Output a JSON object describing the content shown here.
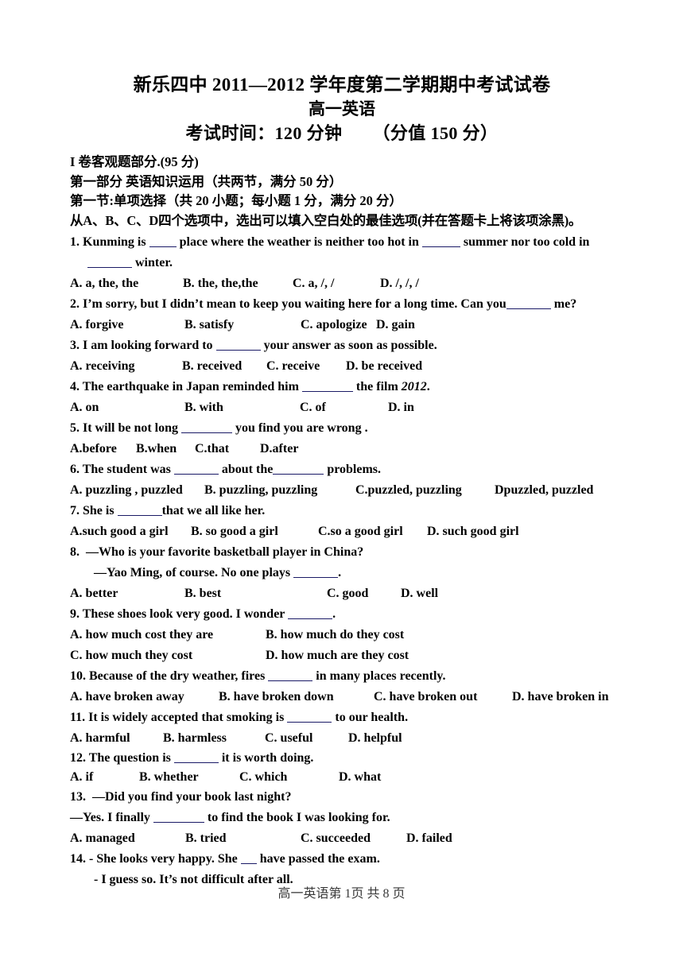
{
  "header": {
    "title_main": "新乐四中 2011—2012 学年度第二学期期中考试试卷",
    "title_sub": "高一英语",
    "exam_time_label": "考试时间：120 分钟",
    "exam_score_label": "（分值 150 分）"
  },
  "instructions": {
    "line1": "I 卷客观题部分.(95 分)",
    "line2": "第一部分 英语知识运用（共两节，满分 50 分）",
    "line3": "第一节:单项选择（共 20 小题；每小题 1 分，满分 20 分）",
    "line4": "从A、B、C、D四个选项中，选出可以填入空白处的最佳选项(并在答题卡上将该项涂黑)。"
  },
  "questions": [
    {
      "number": "1.",
      "stem_part1": "Kunming is",
      "stem_part2": "place where the weather is neither too hot in",
      "stem_part3": "summer nor too cold in",
      "stem_part4": "winter.",
      "options": [
        "A. a, the, the",
        "B. the, the,the",
        "C. a, /, /",
        "D. /, /, /"
      ]
    },
    {
      "number": "2.",
      "stem_part1": "I’m sorry, but I didn’t mean to keep you waiting here for a long time. Can you",
      "stem_part2": "me?",
      "options": [
        "A. forgive",
        "B. satisfy",
        "C. apologize",
        "D. gain"
      ]
    },
    {
      "number": "3.",
      "stem_part1": "I am looking forward to",
      "stem_part2": "your answer as soon as possible.",
      "options": [
        "A. receiving",
        "B. received",
        "C. receive",
        "D. be received"
      ]
    },
    {
      "number": "4.",
      "stem_part1": "The earthquake in Japan reminded him",
      "stem_part2": "the film",
      "stem_italic": "2012",
      "stem_part3": ".",
      "options": [
        "A. on",
        "B. with",
        "C. of",
        "D. in"
      ]
    },
    {
      "number": "5.",
      "stem_part1": "It will be not long",
      "stem_part2": "you find you are wrong .",
      "options": [
        "A.before",
        "B.when",
        "C.that",
        "D.after"
      ]
    },
    {
      "number": "6.",
      "stem_part1": "The student was",
      "stem_part2": "about the",
      "stem_part3": "problems.",
      "options": [
        "A. puzzling , puzzled",
        "B. puzzling, puzzling",
        "C.puzzled, puzzling",
        "Dpuzzled, puzzled"
      ]
    },
    {
      "number": "7.",
      "stem_part1": "She is",
      "stem_part2": "that we all like her.",
      "options": [
        "A.such good a girl",
        "B. so good a girl",
        "C.so a good girl",
        "D. such good girl"
      ]
    },
    {
      "number": "8.",
      "stem_part1": "—Who is your favorite basketball player in China?",
      "stem_line2_part1": "—Yao Ming, of course. No one plays",
      "stem_line2_part2": ".",
      "options": [
        "A. better",
        "B. best",
        "C. good",
        "D. well"
      ]
    },
    {
      "number": "9.",
      "stem_part1": "These shoes look very good. I wonder",
      "stem_part2": ".",
      "options": [
        "A. how much cost they are",
        "B. how much do they cost",
        "C. how much they cost",
        "D. how much are they cost"
      ]
    },
    {
      "number": "10.",
      "stem_part1": "Because of the dry weather, fires",
      "stem_part2": "in many places recently.",
      "options": [
        "A. have broken away",
        "B. have broken down",
        "C. have broken out",
        "D. have broken in"
      ]
    },
    {
      "number": "11.",
      "stem_part1": "It is widely accepted that smoking is",
      "stem_part2": "to our health.",
      "options": [
        "A. harmful",
        "B. harmless",
        "C. useful",
        "D. helpful"
      ]
    },
    {
      "number": "12.",
      "stem_part1": "The question is",
      "stem_part2": "it is worth doing.",
      "options": [
        "A. if",
        "B. whether",
        "C. which",
        "D. what"
      ]
    },
    {
      "number": "13.",
      "stem_part1": "—Did you find your book last night?",
      "stem_line2_part1": "—Yes. I finally",
      "stem_line2_part2": "to find the book I was looking for.",
      "options": [
        "A. managed",
        "B. tried",
        "C. succeeded",
        "D. failed"
      ]
    },
    {
      "number": "14.",
      "stem_part1": "- She looks very happy. She",
      "stem_part2": "have passed the exam.",
      "stem_line2": "- I guess so. It’s not difficult after all."
    }
  ],
  "footer": {
    "text": "高一英语第 1页 共 8 页"
  }
}
